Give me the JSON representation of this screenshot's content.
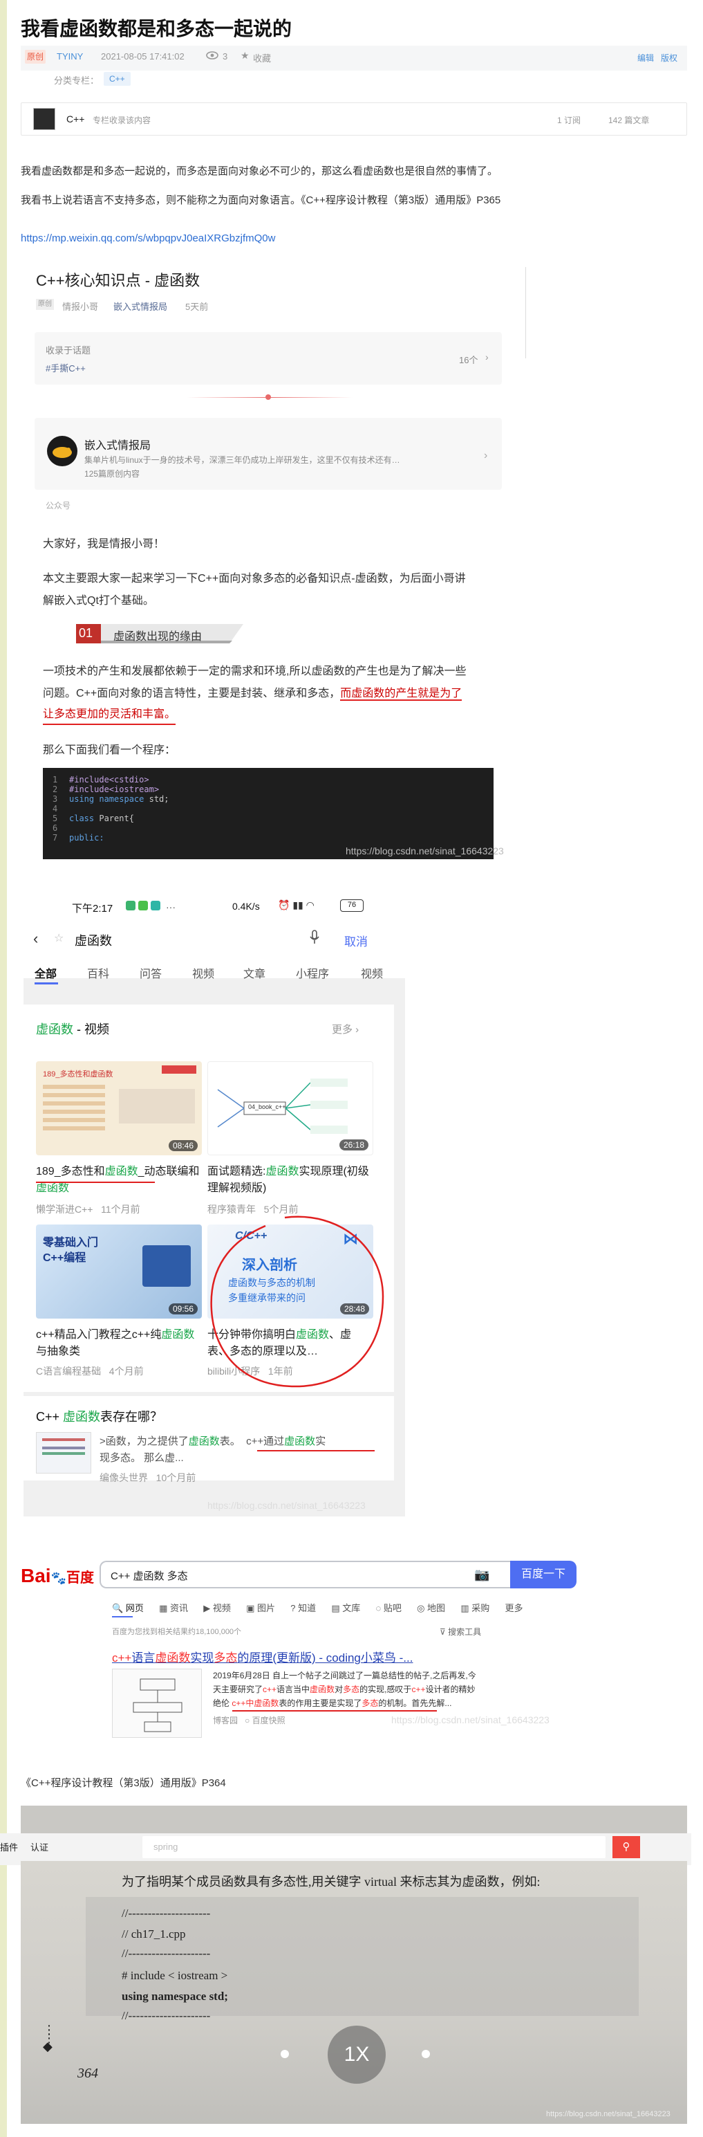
{
  "article": {
    "title": "我看虚函数都是和多态一起说的",
    "badge": "原创",
    "author": "TYINY",
    "datetime": "2021-08-05 17:41:02",
    "views": "3",
    "favorite_label": "收藏",
    "edit_label": "编辑",
    "copyright_label": "版权",
    "category_label": "分类专栏：",
    "category_tag": "C++",
    "column_name": "C++",
    "column_desc": "专栏收录该内容",
    "column_subs": "1 订阅",
    "column_articles": "142 篇文章",
    "para1": "我看虚函数都是和多态一起说的，而多态是面向对象必不可少的，那这么看虚函数也是很自然的事情了。",
    "para2": "我看书上说若语言不支持多态，则不能称之为面向对象语言。《C++程序设计教程（第3版）通用版》P365",
    "url": "https://mp.weixin.qq.com/s/wbpqpvJ0eaIXRGbzjfmQ0w",
    "book_ref": "《C++程序设计教程（第3版）通用版》P364"
  },
  "wechat": {
    "title": "C++核心知识点 - 虚函数",
    "orig_badge": "原创",
    "author": "情报小哥",
    "account": "嵌入式情报局",
    "time": "5天前",
    "collection_label": "收录于话题",
    "collection_tag": "#手撕C++",
    "collection_count": "16个",
    "profile_name": "嵌入式情报局",
    "profile_desc": "集单片机与linux于一身的技术号，深漂三年仍成功上岸研发生，这里不仅有技术还有…",
    "profile_count": "125篇原创内容",
    "profile_type": "公众号",
    "greeting": "大家好，我是情报小哥！",
    "intro1": "本文主要跟大家一起来学习一下C++面向对象多态的必备知识点-虚函数，为后面小哥讲",
    "intro2": "解嵌入式Qt打个基础。",
    "section_num": "01",
    "section_title": "虚函数出现的缘由",
    "body1": "一项技术的产生和发展都依赖于一定的需求和环境,所以虚函数的产生也是为了解决一些",
    "body2a": "问题。C++面向对象的语言特性，主要是封装、继承和多态，",
    "body2b": "而虚函数的产生就是为了",
    "body3": "让多态更加的灵活和丰富。",
    "lead": "那么下面我们看一个程序：",
    "code": {
      "l1n": "1",
      "l1a": "#include",
      "l1b": "<cstdio>",
      "l2n": "2",
      "l2a": "#include",
      "l2b": "<iostream>",
      "l3n": "3",
      "l3a": "using namespace",
      "l3b": " std;",
      "l4n": "4",
      "l5n": "5",
      "l5a": "class",
      "l5b": " Parent{",
      "l6n": "6",
      "l7n": "7",
      "l7a": "public:"
    },
    "watermark": "https://blog.csdn.net/sinat_16643223"
  },
  "phone": {
    "status_time": "下午2:17",
    "status_speed": "0.4K/s",
    "battery": "76",
    "query": "虚函数",
    "cancel": "取消",
    "tabs": [
      "全部",
      "百科",
      "问答",
      "视频",
      "文章",
      "小程序",
      "视频"
    ],
    "video_section_hl": "虚函数",
    "video_section": " - 视频",
    "more": "更多",
    "videos": [
      {
        "duration": "08:46",
        "title_a": "189_多态性和",
        "title_hl": "虚函数",
        "title_b": "_动态联编和",
        "title_hl2": "虚函数",
        "source": "懒学渐进C++",
        "age": "11个月前"
      },
      {
        "duration": "26:18",
        "title_a": "面试题精选:",
        "title_hl": "虚函数",
        "title_b": "实现原理(初级理解视频版)",
        "title_hl2": "",
        "source": "程序猿青年",
        "age": "5个月前"
      },
      {
        "duration": "09:56",
        "title_a": "c++精品入门教程之c++纯",
        "title_hl": "虚函数",
        "title_b": "与抽象类",
        "title_hl2": "",
        "source": "C语言编程基础",
        "age": "4个月前"
      },
      {
        "duration": "28:48",
        "title_a": "十分钟带你搞明白",
        "title_hl": "虚函数",
        "title_b": "、虚表、多态的原理以及…",
        "title_hl2": "",
        "source": "bilibili小程序",
        "age": "1年前"
      }
    ],
    "thumb1_text": "189_多态性和虚函数",
    "thumb2_text": "04_book_c++",
    "thumb3_text_a": "零基础入门",
    "thumb3_text_b": "C++编程",
    "thumb4_text_a": "C/C++",
    "thumb4_text_b": "深入剖析",
    "thumb4_text_c": "虚函数与多态的机制",
    "thumb4_text_d": "多重继承带来的问",
    "qa_title_a": "C++ ",
    "qa_title_hl": "虚函数",
    "qa_title_b": "表存在哪？",
    "qa_text_a": ">函数，为之提供了",
    "qa_hl1": "虚函数",
    "qa_text_b": "表。",
    "qa_text_c": "c++通过",
    "qa_hl2": "虚函数",
    "qa_text_d": "实",
    "qa_text_e": "现多态。 那么虚...",
    "qa_source": "编像头世界",
    "qa_age": "10个月前",
    "watermark": "https://blog.csdn.net/sinat_16643223"
  },
  "baidu": {
    "logo_a": "Bai",
    "logo_b": "百度",
    "query": "C++ 虚函数 多态",
    "button": "百度一下",
    "tabs": [
      "网页",
      "资讯",
      "视频",
      "图片",
      "知道",
      "文库",
      "贴吧",
      "地图",
      "采购",
      "更多"
    ],
    "result_count": "百度为您找到相关结果约18,100,000个",
    "tools": "搜索工具",
    "res_title_a": "c++",
    "res_title_b": "语言",
    "res_title_c": "虚函数",
    "res_title_d": "实现",
    "res_title_e": "多态",
    "res_title_f": "的原理(更新版) - coding小菜鸟 -...",
    "res_line1": "2019年6月28日  自上一个帖子之间跳过了一篇总结性的帖子,之后再发,今",
    "res_line2a": "天主要研究了",
    "res_line2b": "c++",
    "res_line2c": "语言当中",
    "res_line2d": "虚函数",
    "res_line2e": "对",
    "res_line2f": "多态",
    "res_line2g": "的实现,感叹于",
    "res_line2h": "c++",
    "res_line2i": "设计者的精妙",
    "res_line3a": "绝伦",
    "res_line3b": "c++中虚函数",
    "res_line3c": "表的作用主要是实现了",
    "res_line3d": "多态",
    "res_line3e": "的机制。首先先解...",
    "res_source": "博客园",
    "res_snapshot": "百度快照",
    "watermark": "https://blog.csdn.net/sinat_16643223"
  },
  "book": {
    "bar_a": "插件",
    "bar_b": "认证",
    "bar_search": "spring",
    "line1": "为了指明某个成员函数具有多态性,用关键字 virtual 来标志其为虚函数，例如:",
    "code1": "//---------------------",
    "code2": "//     ch17_1.cpp",
    "code3": "//---------------------",
    "code4": "# include < iostream >",
    "code5": "using namespace std;",
    "code6": "//---------------------",
    "page_num": "364",
    "play_label": "1X",
    "watermark": "https://blog.csdn.net/sinat_16643223"
  }
}
